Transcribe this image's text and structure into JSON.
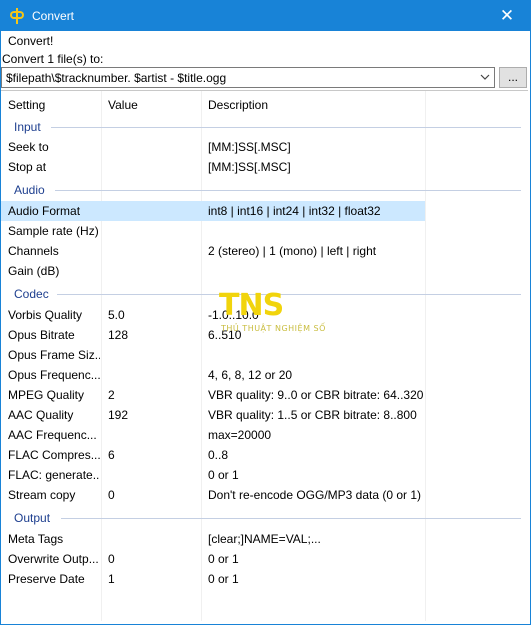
{
  "window": {
    "title": "Convert",
    "close_glyph": "✕"
  },
  "menu": {
    "item": "Convert!"
  },
  "convert_label": "Convert 1 file(s) to:",
  "path": {
    "value": "$filepath\\$tracknumber. $artist - $title.ogg"
  },
  "browse_label": "...",
  "columns": {
    "setting": "Setting",
    "value": "Value",
    "description": "Description"
  },
  "groups": {
    "input": "Input",
    "audio": "Audio",
    "codec": "Codec",
    "output": "Output"
  },
  "rows": {
    "seek_to": {
      "setting": "Seek to",
      "value": "",
      "description": "[MM:]SS[.MSC]"
    },
    "stop_at": {
      "setting": "Stop at",
      "value": "",
      "description": "[MM:]SS[.MSC]"
    },
    "audio_format": {
      "setting": "Audio Format",
      "value": "",
      "description": "int8 | int16 | int24 | int32 | float32"
    },
    "sample_rate": {
      "setting": "Sample rate (Hz)",
      "value": "",
      "description": ""
    },
    "channels": {
      "setting": "Channels",
      "value": "",
      "description": "2 (stereo) | 1 (mono) | left | right"
    },
    "gain": {
      "setting": "Gain (dB)",
      "value": "",
      "description": ""
    },
    "vorbis_quality": {
      "setting": "Vorbis Quality",
      "value": "5.0",
      "description": "-1.0..10.0"
    },
    "opus_bitrate": {
      "setting": "Opus Bitrate",
      "value": "128",
      "description": "6..510"
    },
    "opus_frame_size": {
      "setting": "Opus Frame Siz...",
      "value": "",
      "description": ""
    },
    "opus_frequency": {
      "setting": "Opus Frequenc...",
      "value": "",
      "description": "4, 6, 8, 12 or 20"
    },
    "mpeg_quality": {
      "setting": "MPEG Quality",
      "value": "2",
      "description": "VBR quality: 9..0 or CBR bitrate: 64..320"
    },
    "aac_quality": {
      "setting": "AAC Quality",
      "value": "192",
      "description": "VBR quality: 1..5 or CBR bitrate: 8..800"
    },
    "aac_frequency": {
      "setting": "AAC Frequenc...",
      "value": "",
      "description": "max=20000"
    },
    "flac_compression": {
      "setting": "FLAC Compres...",
      "value": "6",
      "description": "0..8"
    },
    "flac_generate": {
      "setting": "FLAC: generate...",
      "value": "",
      "description": "0 or 1"
    },
    "stream_copy": {
      "setting": "Stream copy",
      "value": "0",
      "description": "Don't re-encode OGG/MP3 data (0 or 1)"
    },
    "meta_tags": {
      "setting": "Meta Tags",
      "value": "",
      "description": "[clear;]NAME=VAL;..."
    },
    "overwrite_output": {
      "setting": "Overwrite Outp...",
      "value": "0",
      "description": "0 or 1"
    },
    "preserve_date": {
      "setting": "Preserve Date",
      "value": "1",
      "description": "0 or 1"
    }
  },
  "watermark": {
    "text": "TNS",
    "subtext": "THỦ THUẬT NGHIỆM SỐ"
  },
  "colors": {
    "titlebar": "#1883d7",
    "selection": "#cce8ff",
    "group_text": "#1e3f8f",
    "watermark": "#f1d40c"
  }
}
